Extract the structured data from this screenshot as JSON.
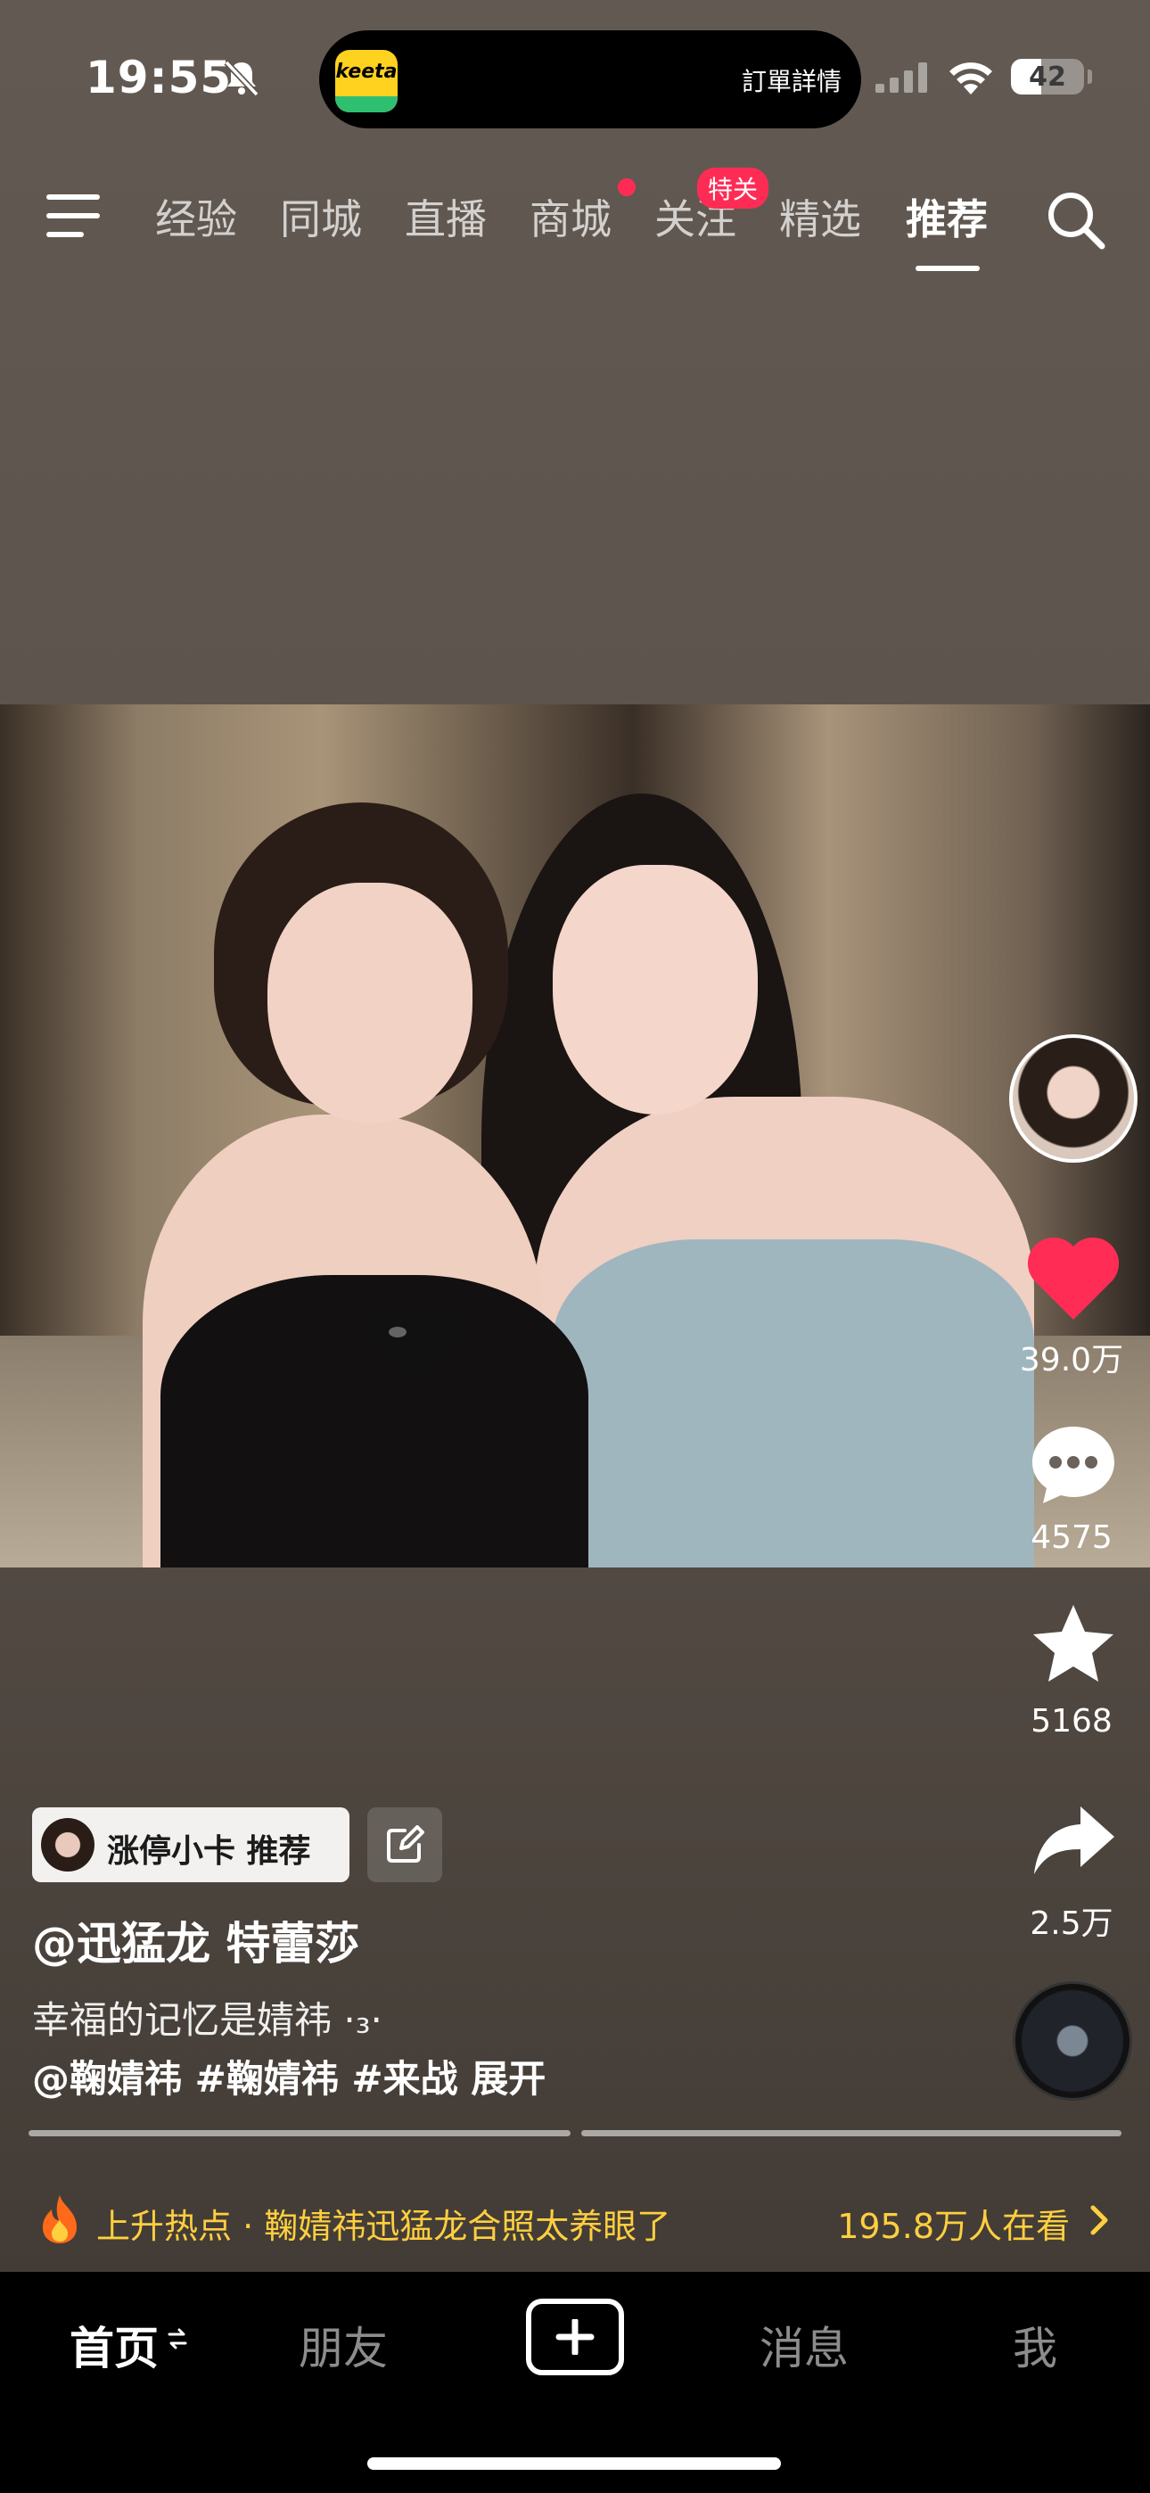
{
  "status_bar": {
    "time": "19:55",
    "island_app": "keeta",
    "island_text": "訂單詳情",
    "battery": "42",
    "battery_level": 0.42
  },
  "top_nav": {
    "tabs": [
      "经验",
      "同城",
      "直播",
      "商城",
      "关注",
      "精选",
      "推荐"
    ],
    "active_tab": "推荐",
    "follow_badge": "特关",
    "mall_has_red_dot": true
  },
  "side_actions": {
    "likes": "39.0万",
    "comments": "4575",
    "favorites": "5168",
    "shares": "2.5万"
  },
  "post": {
    "recommend_chip": "涨停小卡  推荐",
    "author": "@迅猛龙 特蕾莎",
    "caption_line1": "幸福的记忆是婧祎 ·₃·",
    "caption_line2": "@鞠婧祎 #鞠婧祎 #来战  展开"
  },
  "hot_bar": {
    "text": "上升热点 · 鞠婧祎迅猛龙合照太养眼了",
    "viewers": "195.8万人在看"
  },
  "bottom_tabs": {
    "home": "首页",
    "friends": "朋友",
    "messages": "消息",
    "me": "我"
  },
  "colors": {
    "accent_red": "#fe2c55",
    "hot_yellow": "#ffcf3f",
    "like_red": "#ff2d55"
  }
}
